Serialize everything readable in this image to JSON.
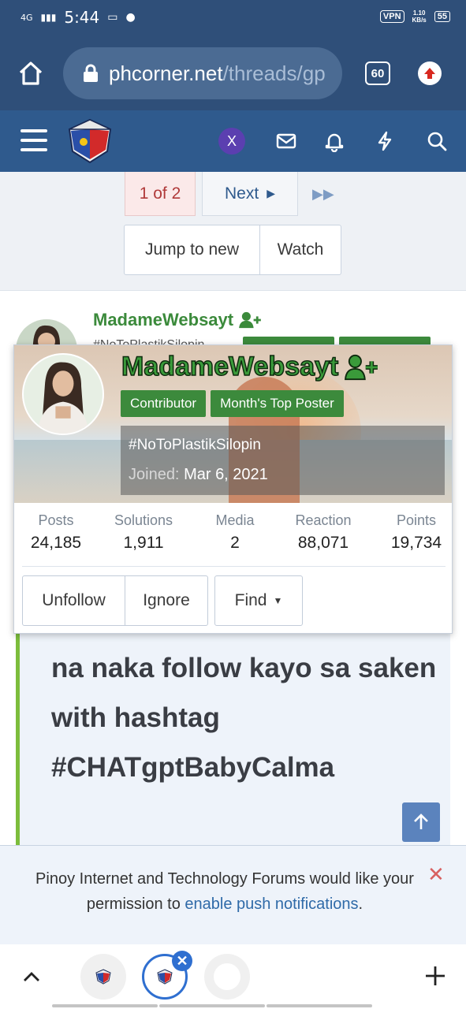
{
  "status_bar": {
    "network": "4G",
    "time": "5:44",
    "vpn": "VPN",
    "speed_value": "1.10",
    "speed_unit": "KB/s",
    "battery": "55"
  },
  "browser": {
    "url_host": "phcorner.net",
    "url_path": "/threads/gp",
    "tab_count": "60"
  },
  "header": {
    "x_badge": "X"
  },
  "pagination": {
    "current": "1 of 2",
    "next_label": "Next"
  },
  "thread_actions": {
    "jump_label": "Jump to new",
    "watch_label": "Watch"
  },
  "post": {
    "username": "MadameWebsayt",
    "user_title_partial": "#NoToPlastikSilopin"
  },
  "member_card": {
    "username": "MadameWebsayt",
    "badges": [
      "Contributor",
      "Month's Top Poster"
    ],
    "custom_title": "#NoToPlastikSilopin",
    "joined_label": "Joined:",
    "joined_date": "Mar 6, 2021",
    "stats": [
      {
        "label": "Posts",
        "value": "24,185"
      },
      {
        "label": "Solutions",
        "value": "1,911"
      },
      {
        "label": "Media",
        "value": "2"
      },
      {
        "label": "Reaction",
        "value": "88,071"
      },
      {
        "label": "Points",
        "value": "19,734"
      }
    ],
    "unfollow_label": "Unfollow",
    "ignore_label": "Ignore",
    "find_label": "Find"
  },
  "quote": {
    "text": "Pasabit ako dalawa, send SS na naka follow kayo sa saken with hashtag #CHATgptBabyCalma"
  },
  "notification": {
    "text_before": "Pinoy Internet and Technology Forums would like your permission to ",
    "link_text": "enable push notifications",
    "text_after": "."
  },
  "icons": {
    "home": "home-icon",
    "lock": "lock-icon",
    "menu": "hamburger-icon",
    "mail": "mail-icon",
    "bell": "bell-icon",
    "bolt": "bolt-icon",
    "search": "search-icon",
    "add_user": "add-user-icon",
    "scroll_top": "arrow-up-icon"
  },
  "colors": {
    "header_bg": "#2f5a8d",
    "browser_bg": "#2f4f79",
    "username_green": "#3a9a3a",
    "badge_green": "#3c8a3c",
    "quote_bar": "#7cbd3c"
  }
}
